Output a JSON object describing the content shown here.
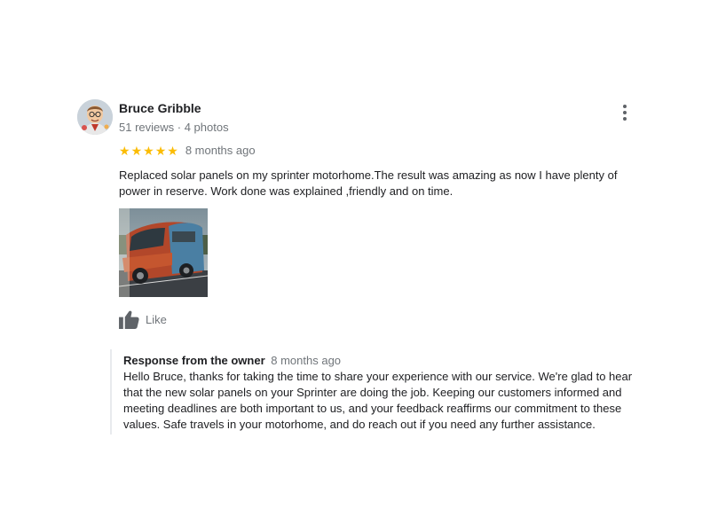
{
  "review": {
    "author": {
      "name": "Bruce Gribble",
      "meta": "51 reviews · 4 photos",
      "avatar_icon": "cartoon-avatar"
    },
    "rating": 5,
    "rating_max": 5,
    "star_color": "#fbbc04",
    "date": "8 months ago",
    "text": "Replaced solar panels on my sprinter motorhome.The  result was amazing  as now I have plenty of power in reserve. Work done was explained ,friendly and on time.",
    "photo_icon": "motorhome-photo",
    "like_label": "Like",
    "menu_icon": "more-vert-icon"
  },
  "owner_response": {
    "label": "Response from the owner",
    "date": "8 months ago",
    "text": "Hello Bruce, thanks for taking the time to share your experience with our service. We're glad to hear that the new solar panels on your Sprinter are doing the job. Keeping our customers informed and meeting deadlines are both important to us, and your feedback reaffirms our commitment to these values. Safe travels in your motorhome, and do reach out if you need any further assistance."
  }
}
